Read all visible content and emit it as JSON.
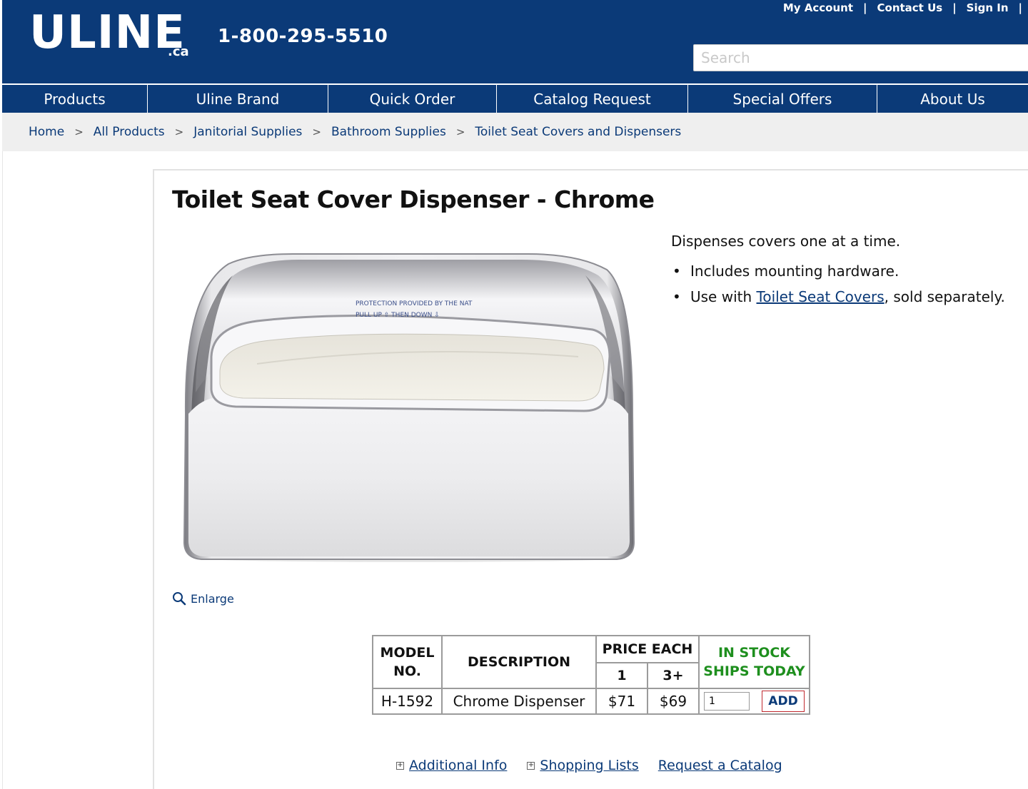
{
  "header": {
    "logo": "ULINE",
    "logo_suffix": ".ca",
    "phone": "1-800-295-5510",
    "top_links": [
      "My Account",
      "Contact Us",
      "Sign In"
    ],
    "separator": "|",
    "search_placeholder": "Search"
  },
  "nav": {
    "items": [
      "Products",
      "Uline Brand",
      "Quick Order",
      "Catalog Request",
      "Special Offers",
      "About Us"
    ]
  },
  "breadcrumb": {
    "items": [
      "Home",
      "All Products",
      "Janitorial Supplies",
      "Bathroom Supplies",
      "Toilet Seat Covers and Dispensers"
    ],
    "separator": ">"
  },
  "product": {
    "title": "Toilet Seat Cover Dispenser - Chrome",
    "image_label_line1": "PROTECTION PROVIDED BY THE NAT",
    "image_label_line2": "PULL UP ⇧  THEN DOWN ⇩",
    "enlarge_label": "Enlarge",
    "description": "Dispenses covers one at a time.",
    "bullet1": "Includes mounting hardware.",
    "bullet2_prefix": "Use with ",
    "bullet2_link": "Toilet Seat Covers",
    "bullet2_suffix": ", sold separately."
  },
  "table": {
    "col_model_line1": "MODEL",
    "col_model_line2": "NO.",
    "col_description": "DESCRIPTION",
    "col_price_each": "PRICE EACH",
    "col_price_1": "1",
    "col_price_3": "3+",
    "stock_line1": "IN STOCK",
    "stock_line2": "SHIPS TODAY",
    "row": {
      "model": "H-1592",
      "description": "Chrome Dispenser",
      "price_1": "$71",
      "price_3": "$69",
      "qty": "1",
      "add_label": "ADD"
    }
  },
  "bottom_links": {
    "additional_info": "Additional Info",
    "shopping_lists": "Shopping Lists",
    "request_catalog": "Request a Catalog",
    "plus": "+"
  },
  "colors": {
    "brand_blue": "#0b3a78",
    "in_stock_green": "#1e8f1e",
    "add_border_red": "#c0282e"
  }
}
